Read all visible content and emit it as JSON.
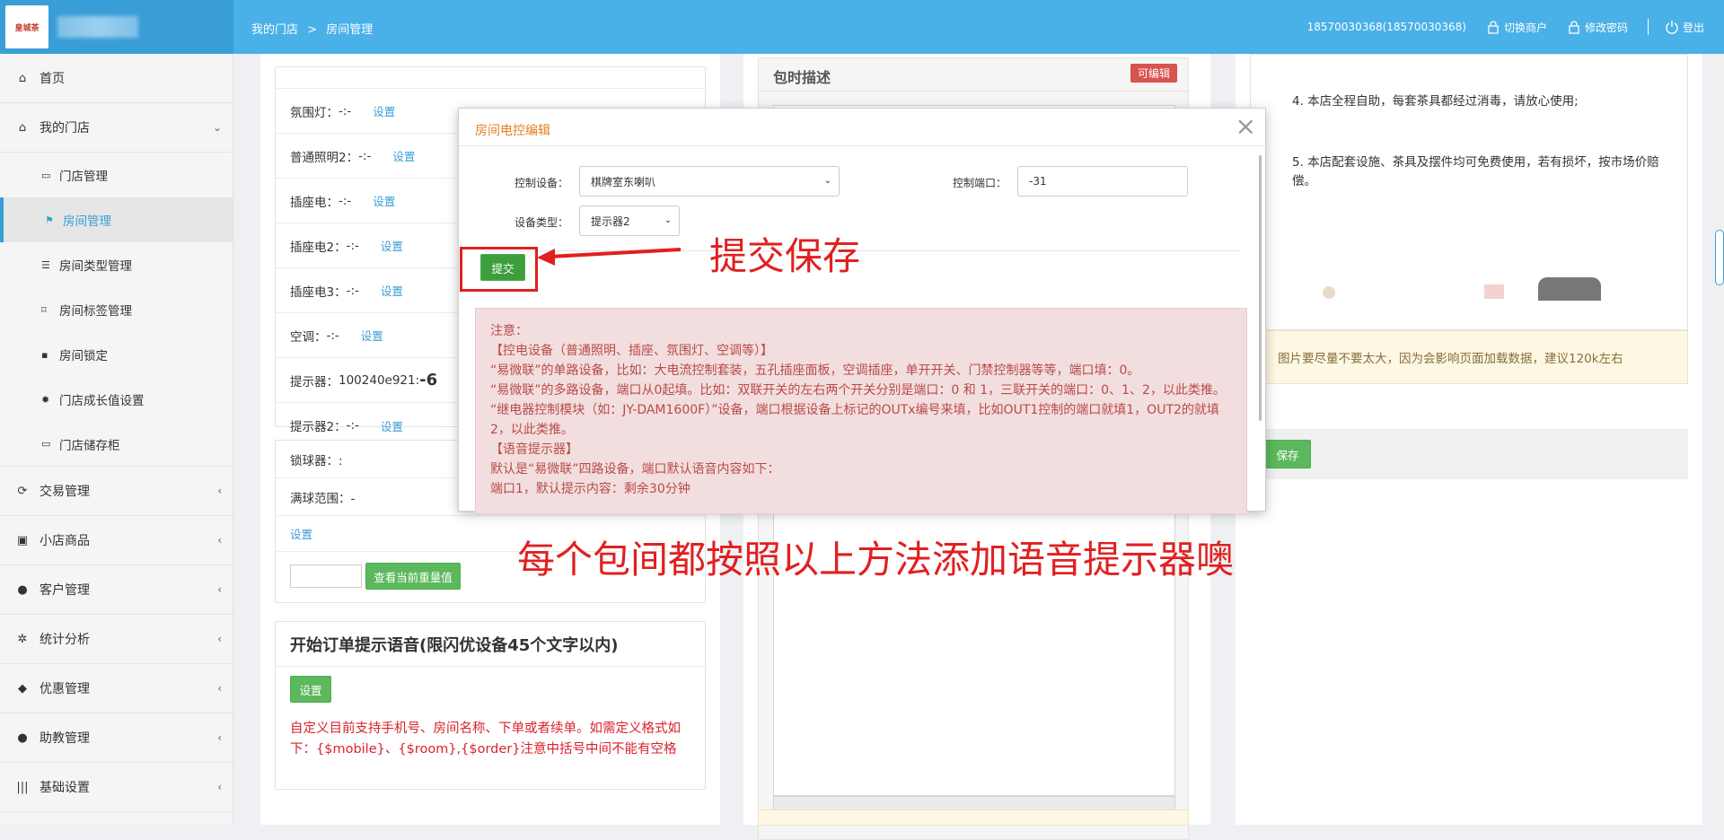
{
  "header": {
    "logo_text": "皇城茶",
    "breadcrumb": [
      "我的门店",
      ">",
      "房间管理"
    ],
    "account": "18570030368(18570030368)",
    "switch_merchant": "切换商户",
    "change_password": "修改密码",
    "logout": "登出",
    "accent_color": "#4ab0e8"
  },
  "sidebar": {
    "items": [
      {
        "label": "首页",
        "icon": "home-icon"
      },
      {
        "label": "我的门店",
        "icon": "home-icon",
        "expanded": true
      },
      {
        "label": "门店管理",
        "icon": "store-icon"
      },
      {
        "label": "房间管理",
        "icon": "flag-icon",
        "active": true
      },
      {
        "label": "房间类型管理",
        "icon": "list-icon"
      },
      {
        "label": "房间标签管理",
        "icon": "bookmark-icon"
      },
      {
        "label": "房间锁定",
        "icon": "lock-icon"
      },
      {
        "label": "门店成长值设置",
        "icon": "gear-icon"
      },
      {
        "label": "门店储存柜",
        "icon": "store-icon"
      },
      {
        "label": "交易管理",
        "icon": "refresh-icon"
      },
      {
        "label": "小店商品",
        "icon": "gift-icon"
      },
      {
        "label": "客户管理",
        "icon": "user-icon"
      },
      {
        "label": "统计分析",
        "icon": "gear-icon"
      },
      {
        "label": "优惠管理",
        "icon": "tag-icon"
      },
      {
        "label": "助教管理",
        "icon": "user-icon"
      },
      {
        "label": "基础设置",
        "icon": "barcode-icon"
      }
    ]
  },
  "left_panel": {
    "rows": [
      {
        "label": "氛围灯：",
        "value": "-:-",
        "action": "设置"
      },
      {
        "label": "普通照明2：",
        "value": "-:-",
        "action": "设置"
      },
      {
        "label": "插座电：",
        "value": "-:-",
        "action": "设置"
      },
      {
        "label": "插座电2：",
        "value": "-:-",
        "action": "设置"
      },
      {
        "label": "插座电3：",
        "value": "-:-",
        "action": "设置"
      },
      {
        "label": "空调：",
        "value": "-:-",
        "action": "设置"
      },
      {
        "label": "提示器：",
        "value": "100240e921:",
        "value_big": "-6",
        "action": "设置"
      },
      {
        "label": "提示器2：",
        "value": "-:-",
        "action": "设置"
      }
    ],
    "lock": "锁球器：:",
    "full_range": "满球范围：-",
    "set_link": "设置",
    "weight_button": "查看当前重量值",
    "voice_title": "开始订单提示语音(限闪优设备45个文字以内)",
    "voice_button": "设置",
    "voice_note": "自定义目前支持手机号、房间名称、下单或者续单。如需定义格式如下：{$mobile}、{$room},{$order}注意中括号中间不能有空格"
  },
  "middle_panel": {
    "title": "包时描述",
    "editable_badge": "可编辑"
  },
  "right_panel": {
    "line4": "4. 本店全程自助，每套茶具都经过消毒，请放心使用;",
    "line5": "5. 本店配套设施、茶具及摆件均可免费使用，若有损坏，按市场价赔偿。",
    "img_tip": "图片要尽量不要太大，因为会影响页面加载数据，建议120k左右",
    "save_button": "保存"
  },
  "modal": {
    "title": "房间电控编辑",
    "control_device_label": "控制设备：",
    "control_device_value": "棋牌室东喇叭",
    "control_port_label": "控制端口：",
    "control_port_value": "-31",
    "device_type_label": "设备类型：",
    "device_type_value": "提示器2",
    "submit": "提交",
    "notice": [
      "注意：",
      "【控电设备（普通照明、插座、氛围灯、空调等）】",
      "“易微联”的单路设备，比如：大电流控制套装，五孔插座面板，空调插座，单开开关、门禁控制器等等，端口填：0。",
      "“易微联”的多路设备，端口从0起填。比如：双联开关的左右两个开关分别是端口：0 和 1，三联开关的端口：0、1、2，以此类推。",
      "“继电器控制模块（如：JY-DAM1600F）”设备，端口根据设备上标记的OUTx编号来填，比如OUT1控制的端口就填1，OUT2的就填2，以此类推。",
      "【语音提示器】",
      "默认是“易微联”四路设备，端口默认语音内容如下：",
      "端口1，默认提示内容：剩余30分钟"
    ]
  },
  "annotations": {
    "submit_note": "提交保存",
    "bottom_note": "每个包间都按照以上方法添加语音提示器噢"
  }
}
